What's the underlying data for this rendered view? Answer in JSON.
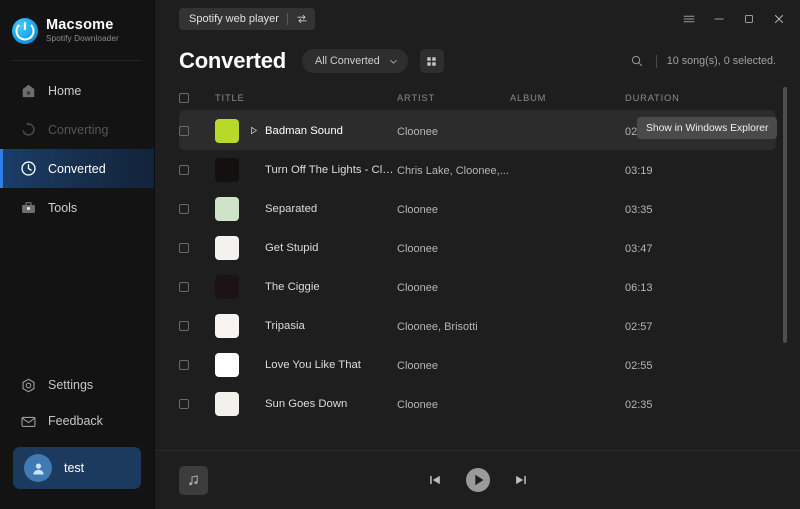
{
  "brand": {
    "name": "Macsome",
    "subtitle": "Spotify Downloader"
  },
  "sidebar": {
    "items": [
      {
        "label": "Home",
        "icon": "home-icon",
        "state": "normal"
      },
      {
        "label": "Converting",
        "icon": "refresh-icon",
        "state": "disabled"
      },
      {
        "label": "Converted",
        "icon": "clock-icon",
        "state": "active"
      },
      {
        "label": "Tools",
        "icon": "toolbox-icon",
        "state": "normal"
      }
    ],
    "bottom_items": [
      {
        "label": "Settings",
        "icon": "gear-icon"
      },
      {
        "label": "Feedback",
        "icon": "mail-icon"
      }
    ],
    "user": {
      "name": "test",
      "icon": "user-avatar-icon"
    }
  },
  "titlebar": {
    "web_player_label": "Spotify web player",
    "switch_icon": "swap-icon",
    "menu_icon": "hamburger-menu-icon",
    "minimize_icon": "minimize-icon",
    "maximize_icon": "maximize-icon",
    "close_icon": "close-icon"
  },
  "header": {
    "title": "Converted",
    "filter_value": "All Converted",
    "filter_options": [
      "All Converted"
    ],
    "chevron_icon": "chevron-down-icon",
    "grid_icon": "grid-view-icon",
    "search_icon": "search-icon",
    "song_count": "10 song(s), 0 selected."
  },
  "table": {
    "columns": [
      "TITLE",
      "ARTIST",
      "ALBUM",
      "DURATION"
    ],
    "rows": [
      {
        "title": "Badman Sound",
        "artist": "Cloonee",
        "album": "",
        "duration": "02:56",
        "selected": true,
        "art": "#b9d92a"
      },
      {
        "title": "Turn Off The Lights - Cloone...",
        "artist": "Chris Lake, Cloonee,...",
        "album": "",
        "duration": "03:19",
        "selected": false,
        "art": "#14100f"
      },
      {
        "title": "Separated",
        "artist": "Cloonee",
        "album": "",
        "duration": "03:35",
        "selected": false,
        "art": "#cfe3c9"
      },
      {
        "title": "Get Stupid",
        "artist": "Cloonee",
        "album": "",
        "duration": "03:47",
        "selected": false,
        "art": "#f4f2ef"
      },
      {
        "title": "The Ciggie",
        "artist": "Cloonee",
        "album": "",
        "duration": "06:13",
        "selected": false,
        "art": "#1d1317"
      },
      {
        "title": "Tripasia",
        "artist": "Cloonee, Brisotti",
        "album": "",
        "duration": "02:57",
        "selected": false,
        "art": "#f7f4f2"
      },
      {
        "title": "Love You Like That",
        "artist": "Cloonee",
        "album": "",
        "duration": "02:55",
        "selected": false,
        "art": "#ffffff"
      },
      {
        "title": "Sun Goes Down",
        "artist": "Cloonee",
        "album": "",
        "duration": "02:35",
        "selected": false,
        "art": "#f3f1ee"
      }
    ],
    "row_actions": {
      "folder_icon": "folder-icon",
      "delete_icon": "close-icon"
    },
    "play_icon": "play-triangle-icon"
  },
  "tooltip": {
    "text": "Show in Windows Explorer"
  },
  "player": {
    "thumb_icon": "music-note-icon",
    "prev_icon": "previous-track-icon",
    "play_icon": "play-button-icon",
    "next_icon": "next-track-icon"
  },
  "colors": {
    "accent": "#2f7fe0",
    "user_box": "#1c3a5e",
    "selected_row": "#2c2c2c"
  }
}
